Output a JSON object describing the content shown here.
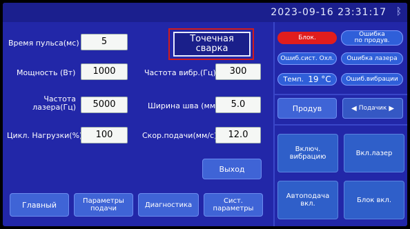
{
  "status": {
    "datetime": "2023-09-16 23:31:17",
    "bluetooth_icon": "bluetooth-icon"
  },
  "params": {
    "pulse_time": {
      "label": "Время пульса(мс)",
      "value": "5"
    },
    "power": {
      "label": "Мощность (Вт)",
      "value": "1000"
    },
    "laser_freq": {
      "label1": "Частота",
      "label2": "лазера(Гц)",
      "value": "5000"
    },
    "duty": {
      "label": "Цикл. Нагрузки(%)",
      "value": "100"
    },
    "vib_freq": {
      "label": "Частота вибр.(Гц)",
      "value": "300"
    },
    "seam_width": {
      "label": "Ширина шва (мм)",
      "value": "5.0"
    },
    "feed_speed": {
      "label": "Скор.подачи(мм/с)",
      "value": "12.0"
    }
  },
  "spot_weld": {
    "line1": "Точечная",
    "line2": "сварка"
  },
  "exit_label": "Выход",
  "nav": {
    "main": "Главный",
    "feed_params1": "Параметры",
    "feed_params2": "подачи",
    "diagnostics": "Диагностика",
    "sys_params1": "Сист.",
    "sys_params2": "параметры"
  },
  "indicators": {
    "block": "Блок.",
    "feed_error1": "Ошибка",
    "feed_error2": "по продув.",
    "cooling_error": "Ошиб.сист. Охл.",
    "laser_error": "Ошибка лазера",
    "temp_label": "Темп.",
    "temp_value": "19 °C",
    "vib_error": "Ошиб.вибрации"
  },
  "purge": {
    "button": "Продув",
    "feeder": "Подачик"
  },
  "actions": {
    "vib_on1": "Включ.",
    "vib_on2": "вибрацию",
    "laser_on": "Вкл.лазер",
    "autofeed1": "Автоподача",
    "autofeed2": "вкл.",
    "lock_on": "Блок вкл."
  },
  "colors": {
    "background": "#2227a8",
    "accent_red": "#d21b1b",
    "button": "#3f64d6"
  }
}
